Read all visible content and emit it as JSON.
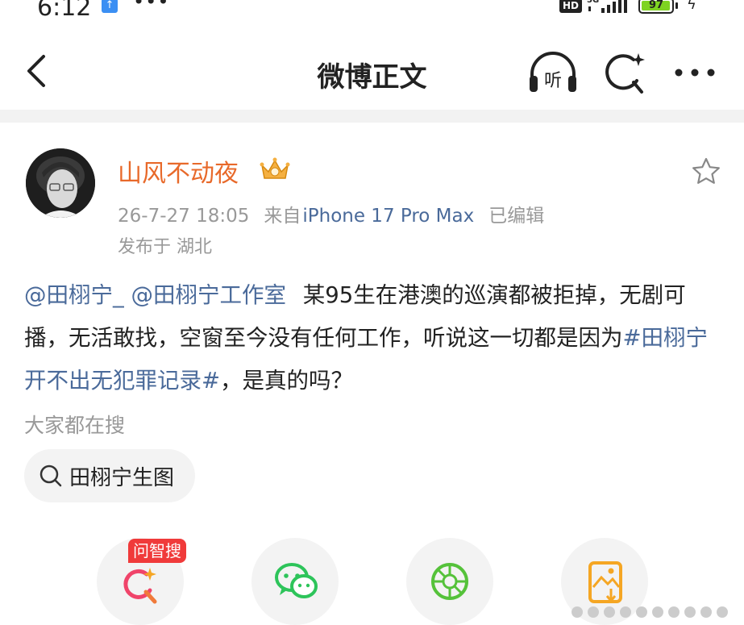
{
  "status_bar": {
    "time": "6:12",
    "dots": "•••",
    "hd": "HD",
    "network": "5G",
    "battery": "97",
    "battery_level": 0.97,
    "colors": {
      "battery_fill": "#7ed321",
      "upload_badge": "#3b8ff3"
    }
  },
  "nav": {
    "title": "微博正文",
    "listen_label": "听"
  },
  "post": {
    "username": "山风不动夜",
    "timestamp": "26-7-27 18:05",
    "source_prefix": "来自",
    "device": "iPhone 17 Pro Max",
    "edited": "已编辑",
    "location": "发布于 湖北",
    "mention1": "@田栩宁_",
    "mention2": "@田栩宁工作室",
    "text_part1": "某95生在港澳的巡演都被拒掉，无剧可播，无活敢找，空窗至今没有任何工作，听说这一切都是因为",
    "hashtag": "#田栩宁开不出无犯罪记录#",
    "text_part2": "，是真的吗？",
    "colors": {
      "username": "#e8692a",
      "link": "#4a6a9a"
    }
  },
  "hot_search": {
    "label": "大家都在搜",
    "query": "田栩宁生图"
  },
  "share": {
    "badge": "问智搜",
    "items": [
      "search-star-icon",
      "wechat-icon",
      "moments-icon",
      "poster-icon"
    ],
    "colors": {
      "badge": "#f03a3a",
      "wechat": "#2dc45a",
      "moments": "#55c23a",
      "poster": "#f5a623"
    }
  }
}
